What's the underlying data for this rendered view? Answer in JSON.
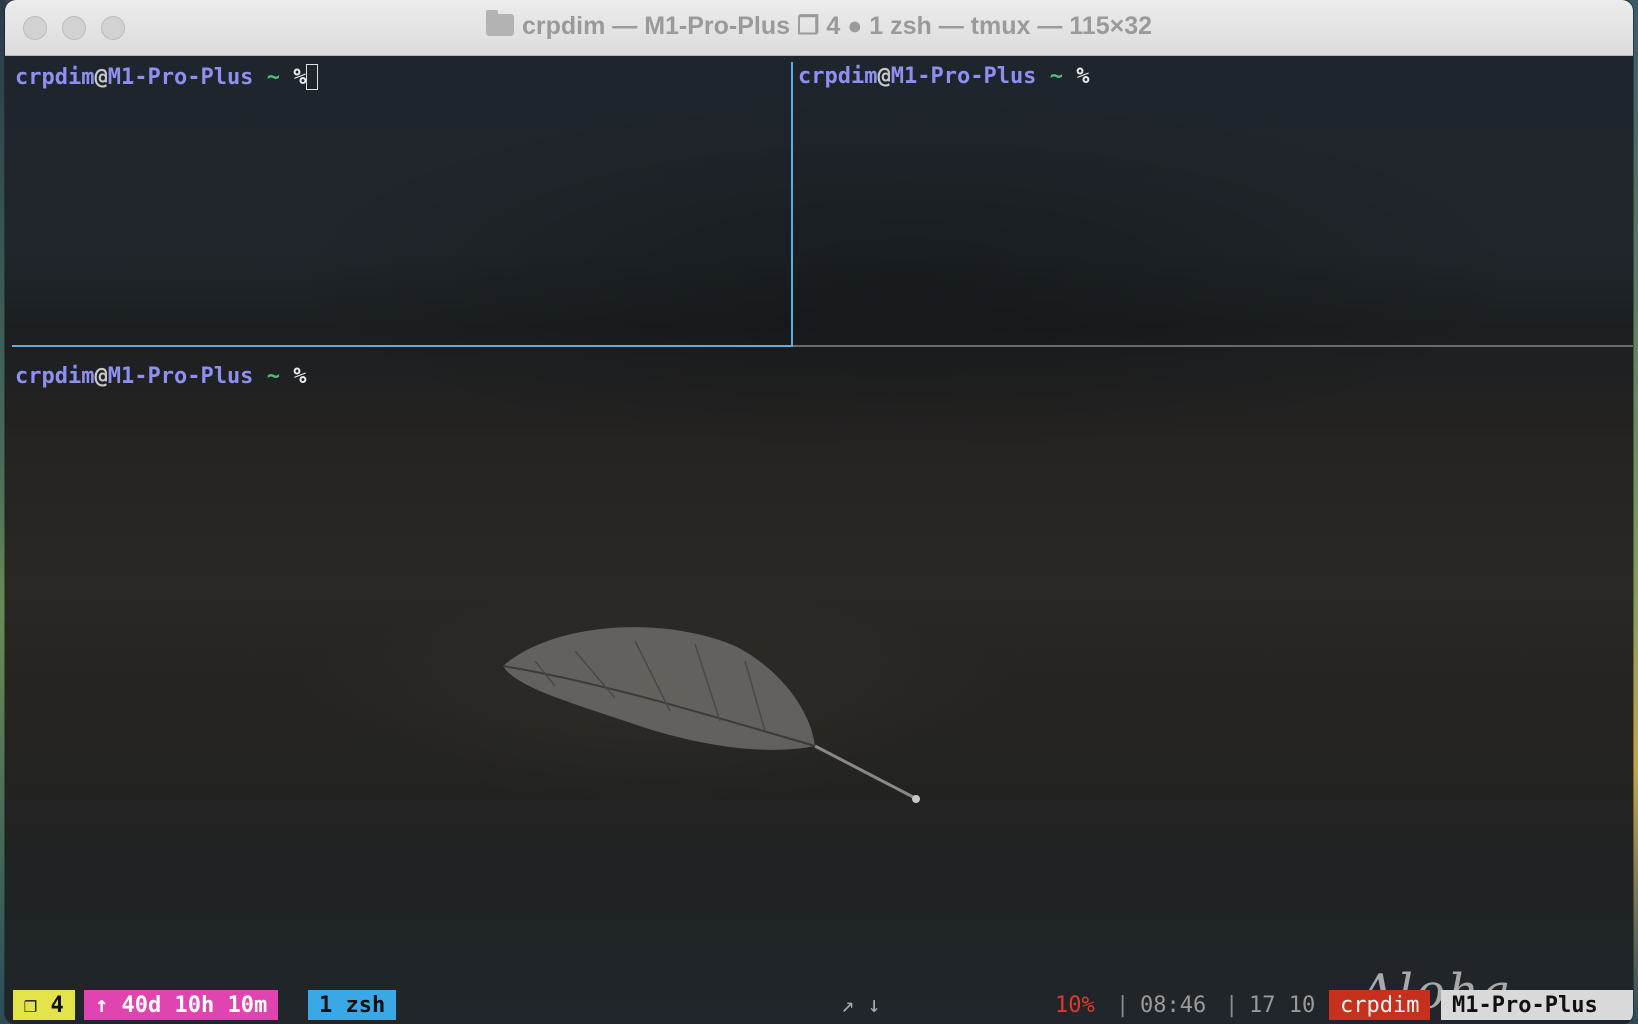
{
  "window": {
    "title": "crpdim — M1-Pro-Plus ❐ 4 ● 1 zsh — tmux — 115×32"
  },
  "panes": {
    "top_left": {
      "user": "crpdim",
      "at": "@",
      "host": "M1-Pro-Plus",
      "cwd": "~",
      "symbol": "%"
    },
    "top_right": {
      "user": "crpdim",
      "at": "@",
      "host": "M1-Pro-Plus",
      "cwd": "~",
      "symbol": "%"
    },
    "bottom": {
      "user": "crpdim",
      "at": "@",
      "host": "M1-Pro-Plus",
      "cwd": "~",
      "symbol": "%"
    }
  },
  "wallpaper": {
    "signature": "Aloha"
  },
  "statusbar": {
    "session": "❐ 4",
    "uptime": "↑ 40d 10h 10m",
    "window": "1 zsh",
    "net_arrows": "↗ ↓",
    "battery_percent": "10%",
    "battery_level": 0.1,
    "sep1": "|",
    "time": "08:46",
    "sep2": "|",
    "date": "17 10",
    "user": "crpdim",
    "host": "M1-Pro-Plus",
    "colors": {
      "session_bg": "#e4e44a",
      "uptime_bg": "#e044b0",
      "window_bg": "#3aa8e6",
      "user_bg": "#c8301e",
      "host_bg": "#d9d9d9",
      "battery": "#e0382a",
      "bar_bg": "#202428"
    }
  }
}
